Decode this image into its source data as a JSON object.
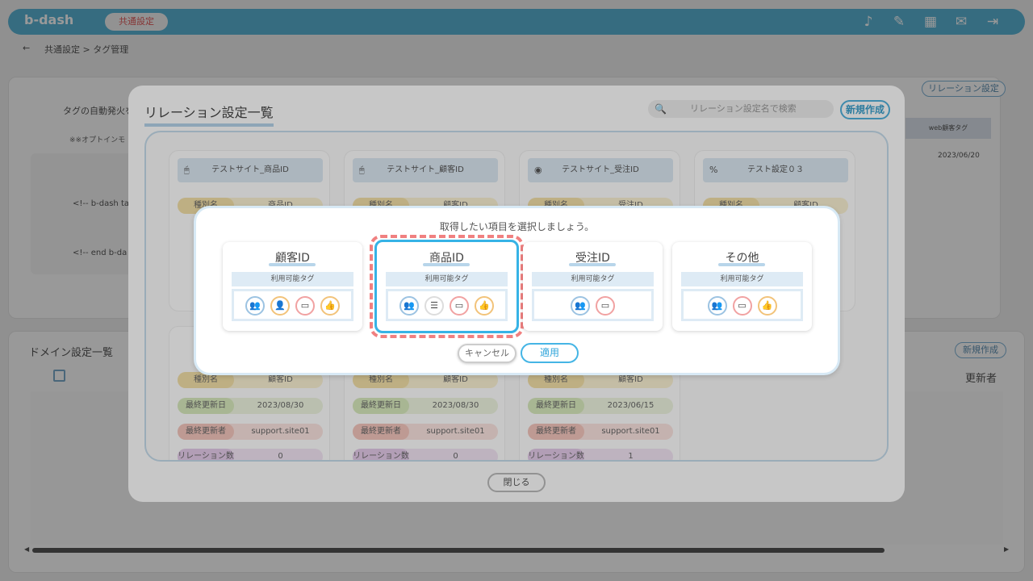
{
  "header": {
    "logo": "b-dash",
    "shared_tag": "共通設定",
    "breadcrumb": "共通設定 > タグ管理"
  },
  "background": {
    "auto_fire_label": "タグの自動発火を",
    "optin_label": "※※オプトインモ",
    "code_lines": [
      "<!-- b-dash ta",
      "<!-- end b-da"
    ],
    "relation_btn": "リレーション設定",
    "web_tag": "web顧客タグ",
    "date": "2023/06/20",
    "domain_title": "ドメイン設定一覧",
    "updated_col": "更新者",
    "domain_new": "新規作成"
  },
  "relation_modal": {
    "title": "リレーション設定一覧",
    "search_placeholder": "リレーション設定名で検索",
    "new_label": "新規作成",
    "close_label": "閉じる",
    "cards_top": [
      {
        "icon": "mouse-icon",
        "glyph": "🖱",
        "name": "テストサイト_商品ID",
        "k1": "種別名",
        "v1": "商品ID"
      },
      {
        "icon": "mouse-icon",
        "glyph": "🖱",
        "name": "テストサイト_顧客ID",
        "k1": "種別名",
        "v1": "顧客ID"
      },
      {
        "icon": "eye-icon",
        "glyph": "◉",
        "name": "テストサイト_受注ID",
        "k1": "種別名",
        "v1": "受注ID"
      },
      {
        "icon": "percent-icon",
        "glyph": "%",
        "name": "テスト設定０３",
        "k1": "種別名",
        "v1": "顧客ID"
      }
    ],
    "cards_bottom": [
      {
        "k1": "種別名",
        "v1": "顧客ID",
        "k2": "最終更新日",
        "v2": "2023/08/30",
        "k3": "最終更新者",
        "v3": "support.site01",
        "k4": "リレーション数",
        "v4": "0"
      },
      {
        "k1": "種別名",
        "v1": "顧客ID",
        "k2": "最終更新日",
        "v2": "2023/08/30",
        "k3": "最終更新者",
        "v3": "support.site01",
        "k4": "リレーション数",
        "v4": "0"
      },
      {
        "k1": "種別名",
        "v1": "顧客ID",
        "k2": "最終更新日",
        "v2": "2023/06/15",
        "k3": "最終更新者",
        "v3": "support.site01",
        "k4": "リレーション数",
        "v4": "1"
      }
    ]
  },
  "dialog": {
    "title": "取得したい項目を選択しましょう。",
    "sub_label": "利用可能タグ",
    "options": [
      {
        "name": "顧客ID"
      },
      {
        "name": "商品ID"
      },
      {
        "name": "受注ID"
      },
      {
        "name": "その他"
      }
    ],
    "cancel_label": "キャンセル",
    "apply_label": "適用"
  }
}
